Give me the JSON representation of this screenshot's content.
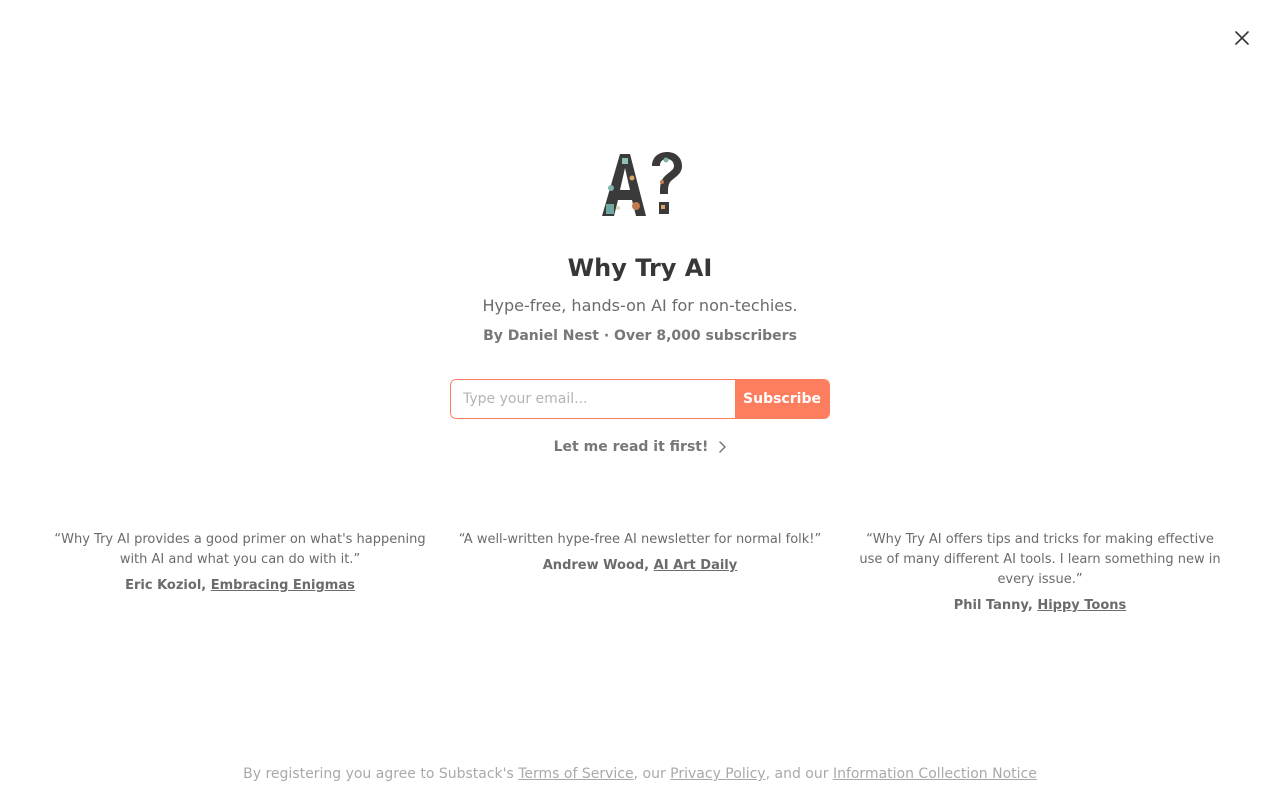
{
  "close": {
    "icon": "close-icon"
  },
  "logo": {
    "icon": "ai-question-logo",
    "alt_text": "A?"
  },
  "publication": {
    "title": "Why Try AI",
    "subtitle": "Hype-free, hands-on AI for non-techies.",
    "byline": "By Daniel Nest · Over 8,000 subscribers"
  },
  "form": {
    "email_placeholder": "Type your email...",
    "email_value": "",
    "subscribe_label": "Subscribe",
    "read_first_label": "Let me read it first!"
  },
  "testimonials": [
    {
      "quote": "“Why Try AI provides a good primer on what's happening with AI and what you can do with it.”",
      "author": "Eric Koziol,",
      "publication": "Embracing Enigmas"
    },
    {
      "quote": "“A well-written hype-free AI newsletter for normal folk!”",
      "author": "Andrew Wood,",
      "publication": "AI Art Daily"
    },
    {
      "quote": "“Why Try AI offers tips and tricks for making effective use of many different AI tools. I learn something new in every issue.”",
      "author": "Phil Tanny,",
      "publication": "Hippy Toons"
    }
  ],
  "footer": {
    "prefix": "By registering you agree to Substack's ",
    "terms": "Terms of Service",
    "sep1": ", our ",
    "privacy": "Privacy Policy",
    "sep2": ", and our ",
    "info": "Information Collection Notice"
  },
  "colors": {
    "accent": "#fd7e5f",
    "text": "#363737",
    "muted": "#6b6b6b"
  }
}
